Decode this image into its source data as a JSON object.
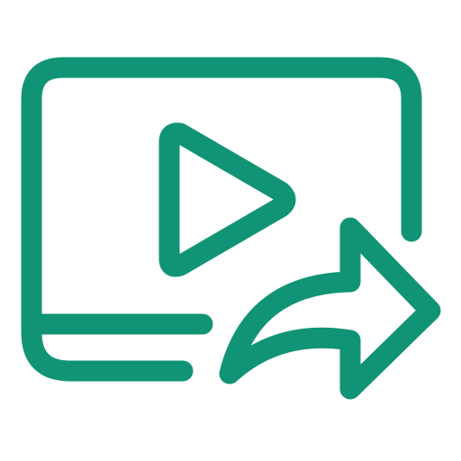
{
  "icon": {
    "name": "share-video-icon",
    "color": "#119475",
    "parts": [
      "video-screen-icon",
      "play-icon",
      "share-arrow-icon"
    ]
  }
}
